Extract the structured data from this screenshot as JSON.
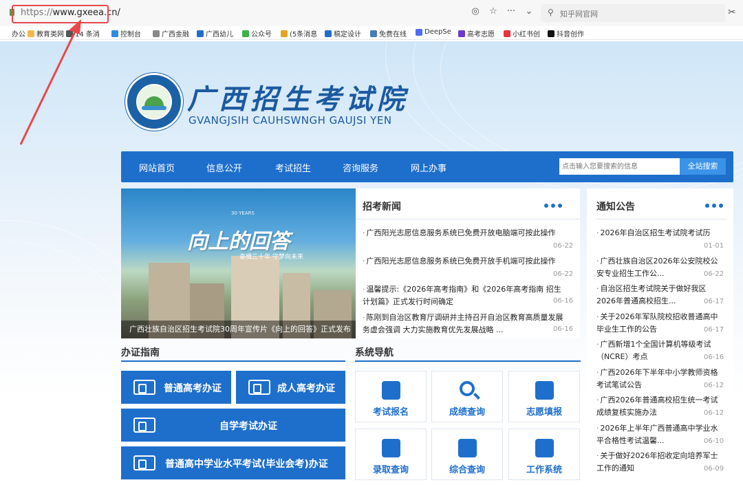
{
  "browser": {
    "url_protocol": "https://",
    "url_host": "www.gxeea.cn/",
    "search_placeholder": "知乎网官网",
    "icons": [
      "location-icon",
      "star-icon",
      "more-icon",
      "chevron-down-icon",
      "search-icon",
      "scissors-icon"
    ],
    "bookmarks": [
      {
        "label": "办公",
        "color": "#ffffff"
      },
      {
        "label": "教育类网",
        "color": "#f2b84b"
      },
      {
        "label": "14 条消",
        "color": "#555555"
      },
      {
        "label": "控制台",
        "color": "#2b8be6"
      },
      {
        "label": "广西金融",
        "color": "#888888"
      },
      {
        "label": "广西幼儿",
        "color": "#1e6fcc"
      },
      {
        "label": "公众号",
        "color": "#3bb34a"
      },
      {
        "label": "(5条消息",
        "color": "#e6a323"
      },
      {
        "label": "稿定设计",
        "color": "#1e6fcc"
      },
      {
        "label": "免费在线",
        "color": "#4a7ab8"
      },
      {
        "label": "DeepSe",
        "color": "#4d6bfe"
      },
      {
        "label": "高考志愿",
        "color": "#6d3ad1"
      },
      {
        "label": "小红书创",
        "color": "#e8323c"
      },
      {
        "label": "抖音创作",
        "color": "#111111"
      }
    ]
  },
  "header": {
    "title": "广西招生考试院",
    "subtitle": "GVANGJSIH CAUHSWNGH GAUJSI YEN"
  },
  "nav": {
    "items": [
      "网站首页",
      "信息公开",
      "考试招生",
      "咨询服务",
      "网上办事"
    ],
    "search_placeholder": "点击输入您要搜索的信息",
    "search_button": "全站搜索"
  },
  "banner": {
    "slogan": "向上的回答",
    "subslogan": "奋楫三十年  守梦向未来",
    "logo_text": "30 YEARS",
    "caption": "广西壮族自治区招生考试院30周年宣传片《向上的回答》正式发布"
  },
  "recruit_news": {
    "title": "招考新闻",
    "items": [
      {
        "lines": [
          "广西阳光志愿信息服务系统已免费开放电脑端可按此操作"
        ],
        "date": "06-22"
      },
      {
        "lines": [
          "广西阳光志愿信息服务系统已免费开放手机端可按此操作"
        ],
        "date": "06-22"
      },
      {
        "lines": [
          "温馨提示:《2026年高考指南》和《2026年高考指南 招生",
          "计划篇》正式发行时间确定"
        ],
        "date": "06-16"
      },
      {
        "lines": [
          "陈刚到自治区教育厅调研并主持召开自治区教育高质量发展",
          "务虚会强调 大力实施教育优先发展战略 ..."
        ],
        "date": "06-16"
      }
    ]
  },
  "notices": {
    "title": "通知公告",
    "items": [
      {
        "lines": [
          "2026年自治区招生考试院考试历"
        ],
        "date": "01-01"
      },
      {
        "lines": [
          "广西壮族自治区2026年公安院校公",
          "安专业招生工作公..."
        ],
        "date": "06-22"
      },
      {
        "lines": [
          "自治区招生考试院关于做好我区",
          "2026年普通高校招生..."
        ],
        "date": "06-17"
      },
      {
        "lines": [
          "关于2026年军队院校招收普通高中",
          "毕业生工作的公告"
        ],
        "date": "06-17"
      },
      {
        "lines": [
          "广西新增1个全国计算机等级考试",
          "（NCRE）考点"
        ],
        "date": "06-16"
      },
      {
        "lines": [
          "广西2026年下半年中小学教师资格",
          "考试笔试公告"
        ],
        "date": "06-12"
      },
      {
        "lines": [
          "广西2026年普通高校招生统一考试",
          "成绩复核实施办法"
        ],
        "date": "06-12"
      },
      {
        "lines": [
          "2026年上半年广西普通高中学业水",
          "平合格性考试温馨..."
        ],
        "date": "06-10"
      },
      {
        "lines": [
          "关于做好2026年招收定向培养军士",
          "工作的通知"
        ],
        "date": "06-09"
      }
    ]
  },
  "guide": {
    "title": "办证指南",
    "buttons": [
      "普通高考办证",
      "成人高考办证",
      "自学考试办证",
      "普通高中学业水平考试(毕业会考)办证"
    ]
  },
  "sysnav": {
    "title": "系统导航",
    "tiles": [
      {
        "label": "考试报名",
        "icon": "exam-signup-icon"
      },
      {
        "label": "成绩查询",
        "icon": "search-icon"
      },
      {
        "label": "志愿填报",
        "icon": "edit-icon"
      },
      {
        "label": "录取查询",
        "icon": "calendar-check-icon"
      },
      {
        "label": "综合查询",
        "icon": "grid-search-icon"
      },
      {
        "label": "工作系统",
        "icon": "sliders-icon"
      }
    ]
  },
  "colors": {
    "brand": "#1e6fcc",
    "bullet": "#e33333",
    "highlight": "#e8484b"
  }
}
